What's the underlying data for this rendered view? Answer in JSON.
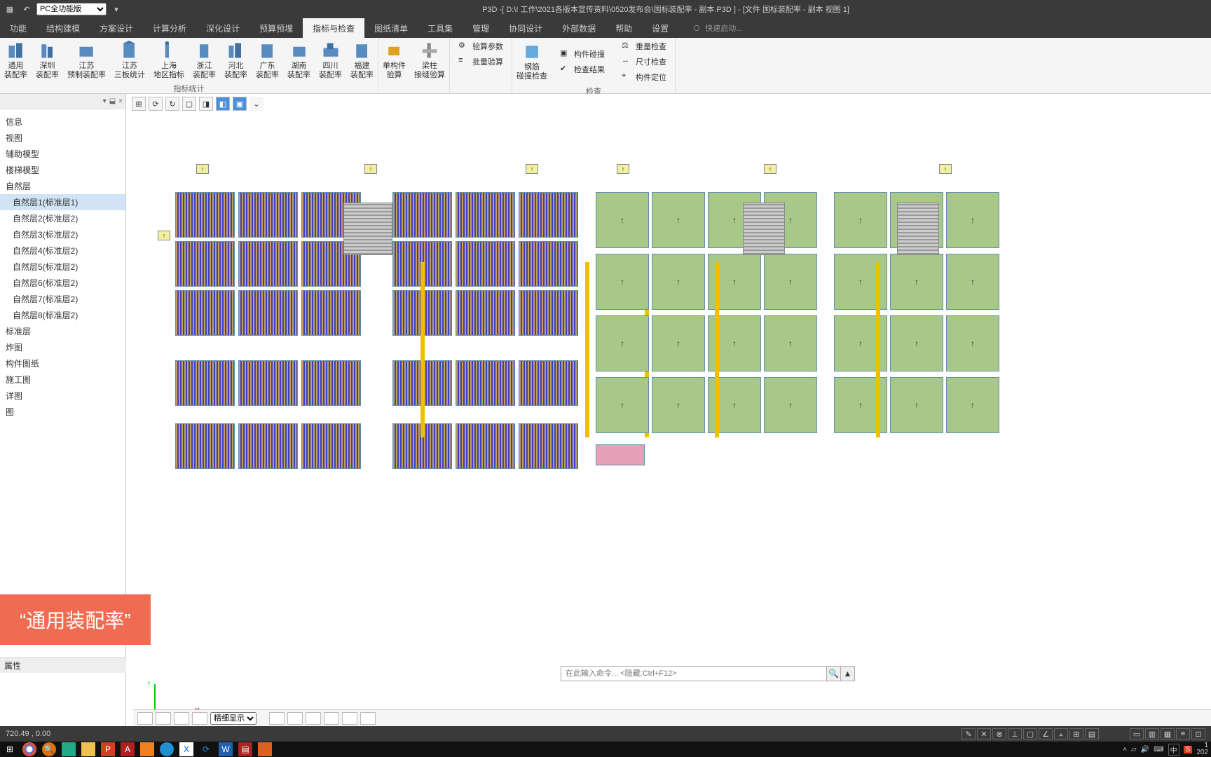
{
  "titlebar": {
    "dropdown_value": "PC全功能版",
    "title": "P3D -[ D:\\!  工作\\2021各版本宣传资料\\0520发布会\\国标装配率 - 副本.P3D ] - [文件 国标装配率 - 副本 视图 1]"
  },
  "menubar": {
    "tabs": [
      "功能",
      "结构建模",
      "方案设计",
      "计算分析",
      "深化设计",
      "预算预埋",
      "指标与检查",
      "图纸清单",
      "工具集",
      "管理",
      "协同设计",
      "外部数据",
      "帮助",
      "设置"
    ],
    "active_index": 6,
    "quick_launch": "快速启动..."
  },
  "ribbon": {
    "group1": {
      "caption": "指标统计",
      "items": [
        {
          "line1": "通用",
          "line2": "装配率"
        },
        {
          "line1": "深圳",
          "line2": "装配率"
        },
        {
          "line1": "江苏",
          "line2": "预制装配率"
        },
        {
          "line1": "江苏",
          "line2": "三板统计"
        },
        {
          "line1": "上海",
          "line2": "地区指标"
        },
        {
          "line1": "浙江",
          "line2": "装配率"
        },
        {
          "line1": "河北",
          "line2": "装配率"
        },
        {
          "line1": "广东",
          "line2": "装配率"
        },
        {
          "line1": "湖南",
          "line2": "装配率"
        },
        {
          "line1": "四川",
          "line2": "装配率"
        },
        {
          "line1": "福建",
          "line2": "装配率"
        }
      ]
    },
    "group2": {
      "items": [
        {
          "line1": "单构件",
          "line2": "验算"
        },
        {
          "line1": "梁柱",
          "line2": "接缝验算"
        }
      ]
    },
    "group3": {
      "items": [
        "验算参数",
        "批量验算"
      ]
    },
    "group4": {
      "caption": "检查",
      "big": {
        "line1": "钢筋",
        "line2": "碰撞检查"
      },
      "small": [
        "构件碰撞",
        "检查结果",
        "尺寸检查",
        "构件定位"
      ],
      "extra": "重量检查"
    }
  },
  "sidebar": {
    "items": [
      {
        "label": "信息",
        "child": false
      },
      {
        "label": "视图",
        "child": false
      },
      {
        "label": "辅助模型",
        "child": false
      },
      {
        "label": "楼梯模型",
        "child": false
      },
      {
        "label": "自然层",
        "child": false
      },
      {
        "label": "自然层1(标准层1)",
        "child": true,
        "selected": true
      },
      {
        "label": "自然层2(标准层2)",
        "child": true
      },
      {
        "label": "自然层3(标准层2)",
        "child": true
      },
      {
        "label": "自然层4(标准层2)",
        "child": true
      },
      {
        "label": "自然层5(标准层2)",
        "child": true
      },
      {
        "label": "自然层6(标准层2)",
        "child": true
      },
      {
        "label": "自然层7(标准层2)",
        "child": true
      },
      {
        "label": "自然层8(标准层2)",
        "child": true
      },
      {
        "label": "标准层",
        "child": false
      },
      {
        "label": "炸图",
        "child": false
      },
      {
        "label": "构件图纸",
        "child": false
      },
      {
        "label": "施工图",
        "child": false
      },
      {
        "label": "详图",
        "child": false
      },
      {
        "label": "图",
        "child": false
      }
    ],
    "prop_title": "属性"
  },
  "callout": "“通用装配率”",
  "cmdbar": {
    "placeholder": "在此输入命令... <隐藏:Ctrl+F12>"
  },
  "lower_toolbar": {
    "display_mode": "精细显示"
  },
  "statusbar": {
    "coords": "720.49 , 0.00"
  },
  "taskbar": {
    "ime": "中",
    "time": "1",
    "date": "202"
  }
}
